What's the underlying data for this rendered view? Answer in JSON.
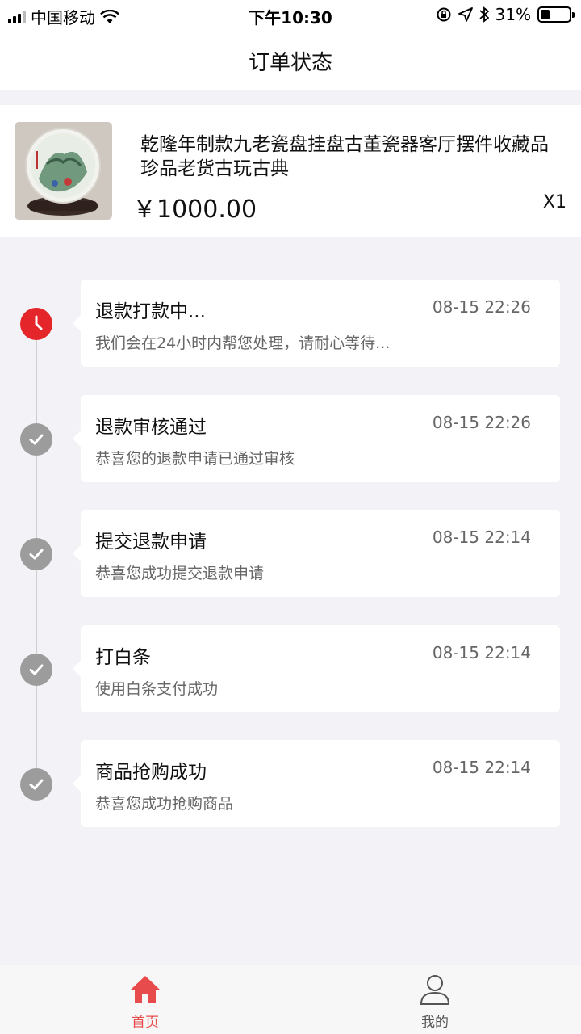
{
  "status_bar": {
    "carrier": "中国移动",
    "time": "下午10:30",
    "battery_percent": "31%",
    "battery_level": 0.31
  },
  "nav": {
    "title": "订单状态"
  },
  "product": {
    "name": "乾隆年制款九老瓷盘挂盘古董瓷器客厅摆件收藏品珍品老货古玩古典",
    "price": "￥1000.00",
    "quantity": "X1"
  },
  "timeline": [
    {
      "title": "退款打款中...",
      "time": "08-15 22:26",
      "desc": "我们会在24小时内帮您处理，请耐心等待...",
      "icon": "clock-icon",
      "active": true
    },
    {
      "title": "退款审核通过",
      "time": "08-15 22:26",
      "desc": "恭喜您的退款申请已通过审核",
      "icon": "check-icon",
      "active": false
    },
    {
      "title": "提交退款申请",
      "time": "08-15 22:14",
      "desc": "恭喜您成功提交退款申请",
      "icon": "check-icon",
      "active": false
    },
    {
      "title": "打白条",
      "time": "08-15 22:14",
      "desc": "使用白条支付成功",
      "icon": "check-icon",
      "active": false
    },
    {
      "title": "商品抢购成功",
      "time": "08-15 22:14",
      "desc": "恭喜您成功抢购商品",
      "icon": "check-icon",
      "active": false
    }
  ],
  "tab_bar": {
    "home_label": "首页",
    "me_label": "我的"
  },
  "colors": {
    "accent": "#e4262a",
    "tab_active": "#e84b4b",
    "done_icon": "#9c9c9c",
    "background": "#f3f3f7"
  }
}
